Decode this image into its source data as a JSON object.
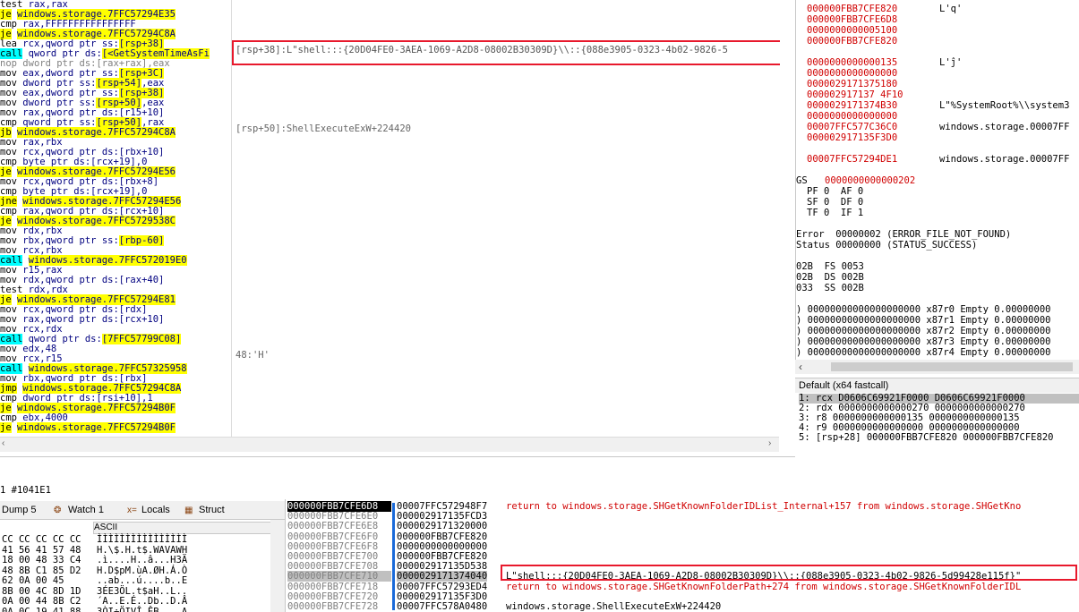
{
  "disasm": [
    {
      "m": "test",
      "mc": "mn",
      "ops": [
        {
          "t": "rax,rax",
          "c": "op"
        }
      ]
    },
    {
      "m": "je",
      "mc": "mn-y",
      "ops": [
        {
          "t": "windows.storage.7FFC57294E35",
          "c": "op-lbl"
        }
      ]
    },
    {
      "m": "cmp",
      "mc": "mn",
      "ops": [
        {
          "t": "rax,FFFFFFFFFFFFFFFF",
          "c": "op"
        }
      ]
    },
    {
      "m": "je",
      "mc": "mn-y",
      "ops": [
        {
          "t": "windows.storage.7FFC57294C8A",
          "c": "op-lbl"
        }
      ]
    },
    {
      "m": "lea",
      "mc": "mn",
      "ops": [
        {
          "t": "rcx,qword ptr ",
          "c": "op"
        },
        {
          "t": "ss:",
          "c": "seg"
        },
        {
          "t": "[rsp+38]",
          "c": "mem"
        }
      ]
    },
    {
      "m": "call",
      "mc": "mn-c",
      "ops": [
        {
          "t": "qword ptr ",
          "c": "op"
        },
        {
          "t": "ds:",
          "c": "seg"
        },
        {
          "t": "[<GetSystemTimeAsFi",
          "c": "mem"
        }
      ]
    },
    {
      "m": "nop",
      "mc": "mn-g",
      "ops": [
        {
          "t": "dword ptr ds:[rax+rax],eax",
          "c": "op-g"
        }
      ]
    },
    {
      "m": "mov",
      "mc": "mn",
      "ops": [
        {
          "t": "eax,dword ptr ",
          "c": "op"
        },
        {
          "t": "ss:",
          "c": "seg"
        },
        {
          "t": "[rsp+3C]",
          "c": "mem"
        }
      ]
    },
    {
      "m": "mov",
      "mc": "mn",
      "ops": [
        {
          "t": "dword ptr ",
          "c": "op"
        },
        {
          "t": "ss:",
          "c": "seg"
        },
        {
          "t": "[rsp+54]",
          "c": "mem"
        },
        {
          "t": ",eax",
          "c": "op"
        }
      ]
    },
    {
      "m": "mov",
      "mc": "mn",
      "ops": [
        {
          "t": "eax,dword ptr ",
          "c": "op"
        },
        {
          "t": "ss:",
          "c": "seg"
        },
        {
          "t": "[rsp+38]",
          "c": "mem"
        }
      ]
    },
    {
      "m": "mov",
      "mc": "mn",
      "ops": [
        {
          "t": "dword ptr ",
          "c": "op"
        },
        {
          "t": "ss:",
          "c": "seg"
        },
        {
          "t": "[rsp+50]",
          "c": "mem"
        },
        {
          "t": ",eax",
          "c": "op"
        }
      ]
    },
    {
      "m": "mov",
      "mc": "mn",
      "ops": [
        {
          "t": "rax,qword ptr ",
          "c": "op"
        },
        {
          "t": "ds:",
          "c": "seg"
        },
        {
          "t": "[r15+10]",
          "c": "op"
        }
      ]
    },
    {
      "m": "cmp",
      "mc": "mn",
      "ops": [
        {
          "t": "qword ptr ",
          "c": "op"
        },
        {
          "t": "ss:",
          "c": "seg"
        },
        {
          "t": "[rsp+50]",
          "c": "mem"
        },
        {
          "t": ",rax",
          "c": "op"
        }
      ]
    },
    {
      "m": "jb",
      "mc": "mn-y",
      "ops": [
        {
          "t": "windows.storage.7FFC57294C8A",
          "c": "op-lbl"
        }
      ]
    },
    {
      "m": "mov",
      "mc": "mn",
      "ops": [
        {
          "t": "rax,rbx",
          "c": "op"
        }
      ]
    },
    {
      "m": "mov",
      "mc": "mn",
      "ops": [
        {
          "t": "rcx,qword ptr ",
          "c": "op"
        },
        {
          "t": "ds:",
          "c": "seg"
        },
        {
          "t": "[rbx+10]",
          "c": "op"
        }
      ]
    },
    {
      "m": "cmp",
      "mc": "mn",
      "ops": [
        {
          "t": "byte ptr ",
          "c": "op"
        },
        {
          "t": "ds:",
          "c": "seg"
        },
        {
          "t": "[rcx+19],0",
          "c": "op"
        }
      ]
    },
    {
      "m": "je",
      "mc": "mn-y",
      "ops": [
        {
          "t": "windows.storage.7FFC57294E56",
          "c": "op-lbl"
        }
      ]
    },
    {
      "m": "mov",
      "mc": "mn",
      "ops": [
        {
          "t": "rcx,qword ptr ",
          "c": "op"
        },
        {
          "t": "ds:",
          "c": "seg"
        },
        {
          "t": "[rbx+8]",
          "c": "op"
        }
      ]
    },
    {
      "m": "cmp",
      "mc": "mn",
      "ops": [
        {
          "t": "byte ptr ",
          "c": "op"
        },
        {
          "t": "ds:",
          "c": "seg"
        },
        {
          "t": "[rcx+19],0",
          "c": "op"
        }
      ]
    },
    {
      "m": "jne",
      "mc": "mn-y",
      "ops": [
        {
          "t": "windows.storage.7FFC57294E56",
          "c": "op-lbl"
        }
      ]
    },
    {
      "m": "cmp",
      "mc": "mn",
      "ops": [
        {
          "t": "rax,qword ptr ",
          "c": "op"
        },
        {
          "t": "ds:",
          "c": "seg"
        },
        {
          "t": "[rcx+10]",
          "c": "op"
        }
      ]
    },
    {
      "m": "je",
      "mc": "mn-y",
      "ops": [
        {
          "t": "windows.storage.7FFC5729538C",
          "c": "op-lbl"
        }
      ]
    },
    {
      "m": "mov",
      "mc": "mn",
      "ops": [
        {
          "t": "rdx,rbx",
          "c": "op"
        }
      ]
    },
    {
      "m": "mov",
      "mc": "mn",
      "ops": [
        {
          "t": "rbx,qword ptr ",
          "c": "op"
        },
        {
          "t": "ss:",
          "c": "seg"
        },
        {
          "t": "[rbp-60]",
          "c": "mem"
        }
      ]
    },
    {
      "m": "mov",
      "mc": "mn",
      "ops": [
        {
          "t": "rcx,rbx",
          "c": "op"
        }
      ]
    },
    {
      "m": "call",
      "mc": "mn-c",
      "ops": [
        {
          "t": "windows.storage.7FFC572019E0",
          "c": "op-lbl"
        }
      ]
    },
    {
      "m": "mov",
      "mc": "mn",
      "ops": [
        {
          "t": "r15,rax",
          "c": "op"
        }
      ]
    },
    {
      "m": "mov",
      "mc": "mn",
      "ops": [
        {
          "t": "rdx,qword ptr ",
          "c": "op"
        },
        {
          "t": "ds:",
          "c": "seg"
        },
        {
          "t": "[rax+40]",
          "c": "op"
        }
      ]
    },
    {
      "m": "test",
      "mc": "mn",
      "ops": [
        {
          "t": "rdx,rdx",
          "c": "op"
        }
      ]
    },
    {
      "m": "je",
      "mc": "mn-y",
      "ops": [
        {
          "t": "windows.storage.7FFC57294E81",
          "c": "op-lbl"
        }
      ]
    },
    {
      "m": "mov",
      "mc": "mn",
      "ops": [
        {
          "t": "rcx,qword ptr ",
          "c": "op"
        },
        {
          "t": "ds:",
          "c": "seg"
        },
        {
          "t": "[rdx]",
          "c": "op"
        }
      ]
    },
    {
      "m": "mov",
      "mc": "mn",
      "ops": [
        {
          "t": "rax,qword ptr ",
          "c": "op"
        },
        {
          "t": "ds:",
          "c": "seg"
        },
        {
          "t": "[rcx+10]",
          "c": "op"
        }
      ]
    },
    {
      "m": "mov",
      "mc": "mn",
      "ops": [
        {
          "t": "rcx,rdx",
          "c": "op"
        }
      ]
    },
    {
      "m": "call",
      "mc": "mn-c",
      "ops": [
        {
          "t": "qword ptr ",
          "c": "op"
        },
        {
          "t": "ds:",
          "c": "seg"
        },
        {
          "t": "[7FFC57799C08]",
          "c": "mem"
        }
      ]
    },
    {
      "m": "mov",
      "mc": "mn",
      "ops": [
        {
          "t": "edx,48",
          "c": "op"
        }
      ]
    },
    {
      "m": "mov",
      "mc": "mn",
      "ops": [
        {
          "t": "rcx,r15",
          "c": "op"
        }
      ]
    },
    {
      "m": "call",
      "mc": "mn-c",
      "ops": [
        {
          "t": "windows.storage.7FFC57325958",
          "c": "op-lbl"
        }
      ]
    },
    {
      "m": "mov",
      "mc": "mn",
      "ops": [
        {
          "t": "rbx,qword ptr ",
          "c": "op"
        },
        {
          "t": "ds:",
          "c": "seg"
        },
        {
          "t": "[rbx]",
          "c": "op"
        }
      ]
    },
    {
      "m": "jmp",
      "mc": "mn-y",
      "ops": [
        {
          "t": "windows.storage.7FFC57294C8A",
          "c": "op-lbl"
        }
      ]
    },
    {
      "m": "cmp",
      "mc": "mn",
      "ops": [
        {
          "t": "dword ptr ",
          "c": "op"
        },
        {
          "t": "ds:",
          "c": "seg"
        },
        {
          "t": "[rsi+10],1",
          "c": "op"
        }
      ]
    },
    {
      "m": "je",
      "mc": "mn-y",
      "ops": [
        {
          "t": "windows.storage.7FFC57294B0F",
          "c": "op-lbl"
        }
      ]
    },
    {
      "m": "cmp",
      "mc": "mn",
      "ops": [
        {
          "t": "ebx,4000",
          "c": "op"
        }
      ]
    },
    {
      "m": "je",
      "mc": "mn-y",
      "ops": [
        {
          "t": "windows.storage.7FFC57294B0F",
          "c": "op-lbl"
        }
      ]
    }
  ],
  "comments": [
    {
      "row": 4,
      "text": "[rsp+38]:L\"shell:::{20D04FE0-3AEA-1069-A2D8-08002B30309D}\\\\::{088e3905-0323-4b02-9826-5",
      "boxed": true
    },
    {
      "row": 12,
      "text": "[rsp+50]:ShellExecuteExW+224420",
      "boxed": false
    },
    {
      "row": 35,
      "text": "48:'H'",
      "boxed": false
    }
  ],
  "regs_top": [
    {
      "addr": "000000FBB7CFE820",
      "cmt": "L'q'"
    },
    {
      "addr": "000000FBB7CFE6D8",
      "cmt": ""
    },
    {
      "addr": "0000000000005100",
      "cmt": ""
    },
    {
      "addr": "000000FBB7CFE820",
      "cmt": ""
    },
    {
      "addr": "",
      "cmt": ""
    },
    {
      "addr": "0000000000000135",
      "cmt": "L'ĵ'"
    },
    {
      "addr": "0000000000000000",
      "cmt": ""
    },
    {
      "addr": "0000029171375180",
      "cmt": ""
    },
    {
      "addr": "000002917137 4F10",
      "cmt": ""
    },
    {
      "addr": "0000029171374B30",
      "cmt": "L\"%SystemRoot%\\\\system3"
    },
    {
      "addr": "0000000000000000",
      "cmt": ""
    },
    {
      "addr": "00007FFC577C36C0",
      "cmt": "windows.storage.00007FF"
    },
    {
      "addr": "000002917135F3D0",
      "cmt": ""
    },
    {
      "addr": "",
      "cmt": ""
    },
    {
      "addr": "00007FFC57294DE1",
      "cmt": "windows.storage.00007FF"
    }
  ],
  "flags": {
    "efl_label": "GS",
    "efl_value": "0000000000000202",
    "row1": "PF 0  AF 0",
    "row2": "SF 0  DF 0",
    "row3": "TF 0  IF 1"
  },
  "errors": {
    "error": "Error  00000002 (ERROR_FILE_NOT_FOUND)",
    "status": "Status 00000000 (STATUS_SUCCESS)"
  },
  "segs": [
    "02B  FS 0053",
    "02B  DS 002B",
    "033  SS 002B"
  ],
  "fpu": [
    ") 00000000000000000000 x87r0 Empty 0.00000000",
    ") 00000000000000000000 x87r1 Empty 0.00000000",
    ") 00000000000000000000 x87r2 Empty 0.00000000",
    ") 00000000000000000000 x87r3 Empty 0.00000000",
    ") 00000000000000000000 x87r4 Empty 0.00000000"
  ],
  "callconv": {
    "title": "Default (x64 fastcall)",
    "args": [
      "1: rcx D0606C69921F0000 D0606C69921F0000",
      "2: rdx 0000000000000270 0000000000000270",
      "3: r8 0000000000000135 0000000000000135",
      "4: r9 0000000000000000 0000000000000000",
      "5: [rsp+28] 000000FBB7CFE820 000000FBB7CFE820"
    ]
  },
  "status": {
    "text": "1 #1041E1"
  },
  "tabs": [
    {
      "label": "Dump 5",
      "icon": "memory-dump-icon"
    },
    {
      "label": "Watch 1",
      "icon": "watch-face-icon"
    },
    {
      "label": "Locals",
      "icon": "locals-x-icon"
    },
    {
      "label": "Struct",
      "icon": "struct-icon"
    }
  ],
  "dump": {
    "ascii_header": "ASCII",
    "rows": [
      {
        "hex": "CC CC CC CC CC",
        "ascii": "ÌÌÌÌÌÌÌÌÌÌÌÌÌÌÌÌ"
      },
      {
        "hex": "41 56 41 57 48",
        "ascii": "H.\\$.H.t$.WAVAWH"
      },
      {
        "hex": "18 00 48 33 C4",
        "ascii": ".ì....H..â...H3Ä"
      },
      {
        "hex": "48 8B C1 85 D2",
        "ascii": "H.D$pM.ùA.ØH.Á.Ò"
      },
      {
        "hex": "62 0A 00 45",
        "ascii": "..ab...ú....b..E"
      },
      {
        "hex": "8B 00 4C 8D 1D",
        "ascii": "3ÉE3ÖL.t$aH..L.."
      },
      {
        "hex": "0A 00 44 8B C2",
        "ascii": "´A..E.É..Db..D.Â"
      },
      {
        "hex": "0A 0C 19 41 88",
        "ascii": "3ÒI÷ÖIVÎ.ÊB....A."
      }
    ]
  },
  "stack": [
    {
      "addr": "000000FBB7CFE6D8",
      "val": "00007FFC572948F7",
      "cmt": "return to windows.storage.SHGetKnownFolderIDList_Internal+157 from windows.storage.SHGetKno",
      "kind": "sel"
    },
    {
      "addr": "000000FBB7CFE6E0",
      "val": "000002917135FCD3",
      "cmt": "",
      "kind": ""
    },
    {
      "addr": "000000FBB7CFE6E8",
      "val": "0000029171320000",
      "cmt": "",
      "kind": ""
    },
    {
      "addr": "000000FBB7CFE6F0",
      "val": "000000FBB7CFE820",
      "cmt": "",
      "kind": ""
    },
    {
      "addr": "000000FBB7CFE6F8",
      "val": "0000000000000000",
      "cmt": "",
      "kind": ""
    },
    {
      "addr": "000000FBB7CFE700",
      "val": "000000FBB7CFE820",
      "cmt": "",
      "kind": ""
    },
    {
      "addr": "000000FBB7CFE708",
      "val": "000002917135D538",
      "cmt": "",
      "kind": ""
    },
    {
      "addr": "000000FBB7CFE710",
      "val": "0000029171374040",
      "cmt": "L\"shell:::{20D04FE0-3AEA-1069-A2D8-08002B30309D}\\\\::{088e3905-0323-4b02-9826-5d99428e115f}\"",
      "kind": "cur"
    },
    {
      "addr": "000000FBB7CFE718",
      "val": "00007FFC57293ED4",
      "cmt": "return to windows.storage.SHGetKnownFolderPath+274 from windows.storage.SHGetKnownFolderIDL",
      "kind": ""
    },
    {
      "addr": "000000FBB7CFE720",
      "val": "000002917135F3D0",
      "cmt": "",
      "kind": ""
    },
    {
      "addr": "000000FBB7CFE728",
      "val": "00007FFC578A0480",
      "cmt": "windows.storage.ShellExecuteExW+224420",
      "kind": ""
    }
  ],
  "colors": {
    "highlight_border": "#e8192c",
    "label_yellow": "#ffff00",
    "call_cyan": "#00ffff",
    "reg_red": "#d00000"
  }
}
